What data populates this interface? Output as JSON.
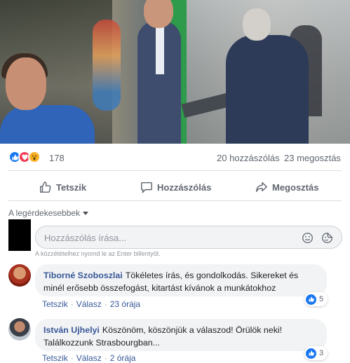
{
  "reactions": {
    "types": [
      "like",
      "love",
      "wow"
    ],
    "count": "178",
    "colors": {
      "like": "#1877f2",
      "love": "#f33e58",
      "wow": "#f7b125"
    }
  },
  "counts": {
    "comments": "20 hozzászólás",
    "shares": "23 megosztás"
  },
  "actions": {
    "like": "Tetszik",
    "comment": "Hozzászólás",
    "share": "Megosztás"
  },
  "sort": {
    "label": "A legérdekesebbek"
  },
  "comment_input": {
    "placeholder": "Hozzászólás írása...",
    "hint": "A közzétételhez nyomd le az Enter billentyűt.",
    "icons": [
      "emoji-icon",
      "sticker-icon"
    ]
  },
  "comments": [
    {
      "author": "Tiborné Szoboszlai",
      "text": "Tökéletes írás, és gondolkodás. Sikereket és minél erősebb összefogást, kitartást kívánok a munkátokhoz",
      "like_label": "Tetszik",
      "reply_label": "Válasz",
      "time": "23 órája",
      "reaction_count": "5"
    },
    {
      "author": "István Ujhelyi",
      "text": "Köszönöm, köszönjük a válaszod! Örülök neki! Találkozzunk Strasbourgban...",
      "like_label": "Tetszik",
      "reply_label": "Válasz",
      "time": "2 órája",
      "reaction_count": "3"
    }
  ],
  "theme": {
    "link_color": "#385898",
    "muted_color": "#606770",
    "bubble_bg": "#f2f3f5"
  }
}
